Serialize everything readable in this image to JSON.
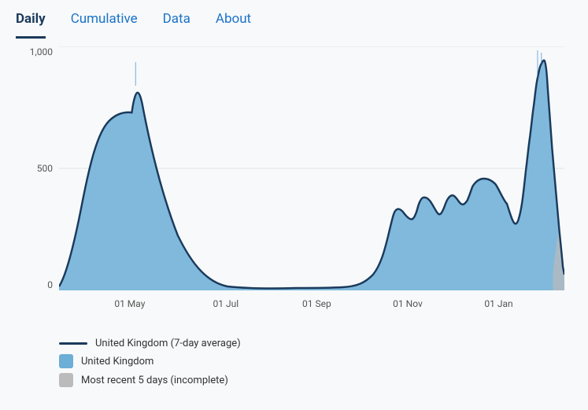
{
  "tabs": [
    {
      "id": "daily",
      "label": "Daily",
      "active": true
    },
    {
      "id": "cumulative",
      "label": "Cumulative",
      "active": false
    },
    {
      "id": "data",
      "label": "Data",
      "active": false
    },
    {
      "id": "about",
      "label": "About",
      "active": false
    }
  ],
  "chart": {
    "yLabels": [
      "1,000",
      "500",
      "0"
    ],
    "xLabels": [
      {
        "text": "01 May",
        "pct": 14
      },
      {
        "text": "01 Jul",
        "pct": 33
      },
      {
        "text": "01 Sep",
        "pct": 51
      },
      {
        "text": "01 Nov",
        "pct": 69
      },
      {
        "text": "01 Jan",
        "pct": 87
      }
    ]
  },
  "legend": {
    "items": [
      {
        "type": "line",
        "label": "United Kingdom (7-day average)"
      },
      {
        "type": "box-blue",
        "label": "United Kingdom"
      },
      {
        "type": "box-gray",
        "label": "Most recent 5 days (incomplete)"
      }
    ]
  }
}
